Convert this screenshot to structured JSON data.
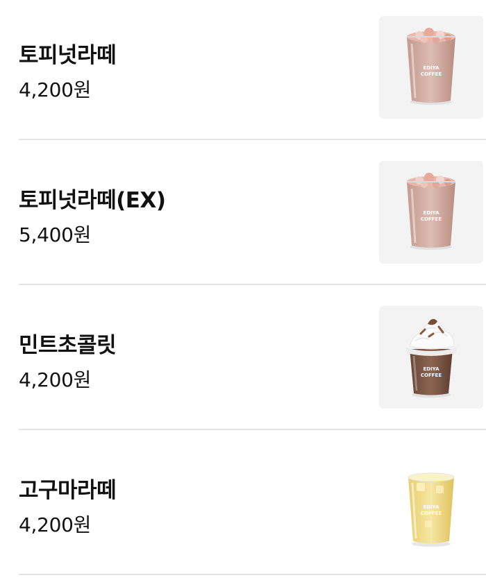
{
  "menu": {
    "items": [
      {
        "name": "토피넛라떼",
        "price": "4,200원",
        "image": "toffee-nut-latte-cup",
        "cup_color": "#caa49a",
        "lid": "flat"
      },
      {
        "name": "토피넛라떼(EX)",
        "price": "5,400원",
        "image": "toffee-nut-latte-cup",
        "cup_color": "#caa49a",
        "lid": "flat"
      },
      {
        "name": "민트초콜릿",
        "price": "4,200원",
        "image": "mint-chocolate-cup",
        "cup_color": "#7b5544",
        "lid": "whipped-cream"
      },
      {
        "name": "고구마라떼",
        "price": "4,200원",
        "image": "sweet-potato-latte-cup",
        "cup_color": "#f1dc8a",
        "lid": "flat"
      }
    ],
    "cup_logo_line1": "EDIYA",
    "cup_logo_line2": "COFFEE"
  }
}
